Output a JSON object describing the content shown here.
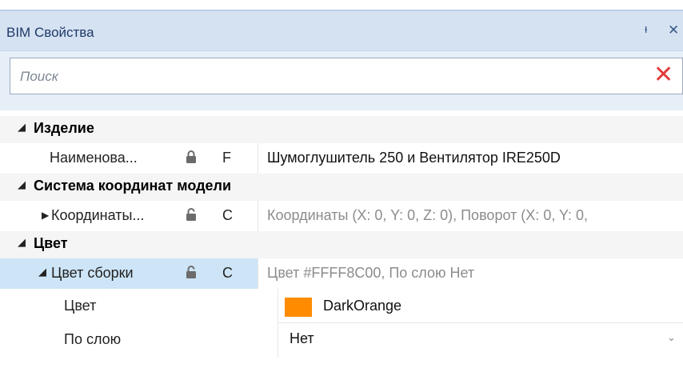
{
  "panel": {
    "title": "BIM Свойства",
    "pin_glyph": "ᵻ",
    "close_glyph": "✕"
  },
  "search": {
    "placeholder": "Поиск",
    "value": "",
    "clear_glyph": "✕"
  },
  "categories": [
    {
      "label": "Изделие",
      "properties": [
        {
          "name": "Наименова...",
          "lock": "locked",
          "kind": "F",
          "value": "Шумоглушитель 250 и Вентилятор IRE250D"
        }
      ]
    },
    {
      "label": "Система координат модели",
      "properties": [
        {
          "name": "Координаты...",
          "lock": "unlocked",
          "kind": "C",
          "value": "Координаты (X: 0, Y: 0, Z: 0), Поворот (X: 0, Y: 0,"
        }
      ]
    },
    {
      "label": "Цвет",
      "properties": [
        {
          "name": "Цвет сборки",
          "lock": "unlocked",
          "kind": "C",
          "value": "Цвет #FFFF8C00, По слою Нет",
          "children": [
            {
              "name": "Цвет",
              "value": "DarkOrange",
              "swatch": "#FF8C00"
            },
            {
              "name": "По слою",
              "value": "Нет"
            }
          ]
        }
      ]
    }
  ],
  "colors": {
    "title_bg": "#d5e2f2",
    "selected_row": "#cde5f7",
    "clear_icon": "#e03a3a",
    "swatch": "#FF8C00"
  }
}
